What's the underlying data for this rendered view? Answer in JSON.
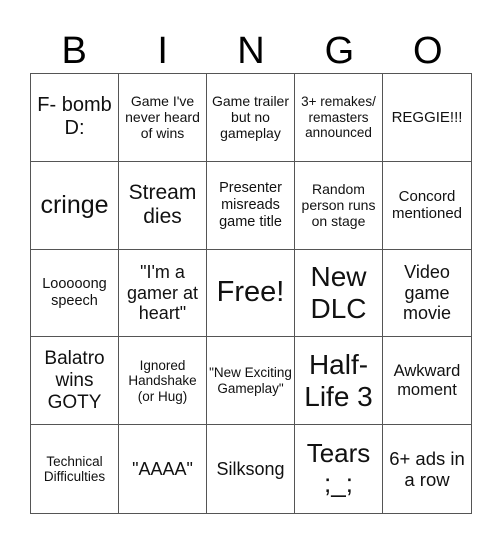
{
  "header": [
    "B",
    "I",
    "N",
    "G",
    "O"
  ],
  "cells": [
    {
      "text": "F- bomb D:",
      "size": 20
    },
    {
      "text": "Game I've never heard of wins",
      "size": 14
    },
    {
      "text": "Game trailer but no gameplay",
      "size": 14
    },
    {
      "text": "3+ remakes/ remasters announced",
      "size": 13.5
    },
    {
      "text": "REGGIE!!!",
      "size": 15
    },
    {
      "text": "cringe",
      "size": 25
    },
    {
      "text": "Stream dies",
      "size": 21
    },
    {
      "text": "Presenter misreads game title",
      "size": 14.5
    },
    {
      "text": "Random person runs on stage",
      "size": 14
    },
    {
      "text": "Concord mentioned",
      "size": 15
    },
    {
      "text": "Looooong speech",
      "size": 14.5
    },
    {
      "text": "\"I'm a gamer at heart\"",
      "size": 18
    },
    {
      "text": "Free!",
      "size": 29
    },
    {
      "text": "New DLC",
      "size": 28
    },
    {
      "text": "Video game movie",
      "size": 18
    },
    {
      "text": "Balatro wins GOTY",
      "size": 19
    },
    {
      "text": "Ignored Handshake (or Hug)",
      "size": 13.5
    },
    {
      "text": "\"New Exciting Gameplay\"",
      "size": 13.5
    },
    {
      "text": "Half- Life 3",
      "size": 28
    },
    {
      "text": "Awkward moment",
      "size": 16.5
    },
    {
      "text": "Technical Difficulties",
      "size": 13.5
    },
    {
      "text": "\"AAAA\"",
      "size": 18
    },
    {
      "text": "Silksong",
      "size": 18
    },
    {
      "text": "Tears ;_;",
      "size": 26
    },
    {
      "text": "6+ ads in a row",
      "size": 18.5
    }
  ]
}
